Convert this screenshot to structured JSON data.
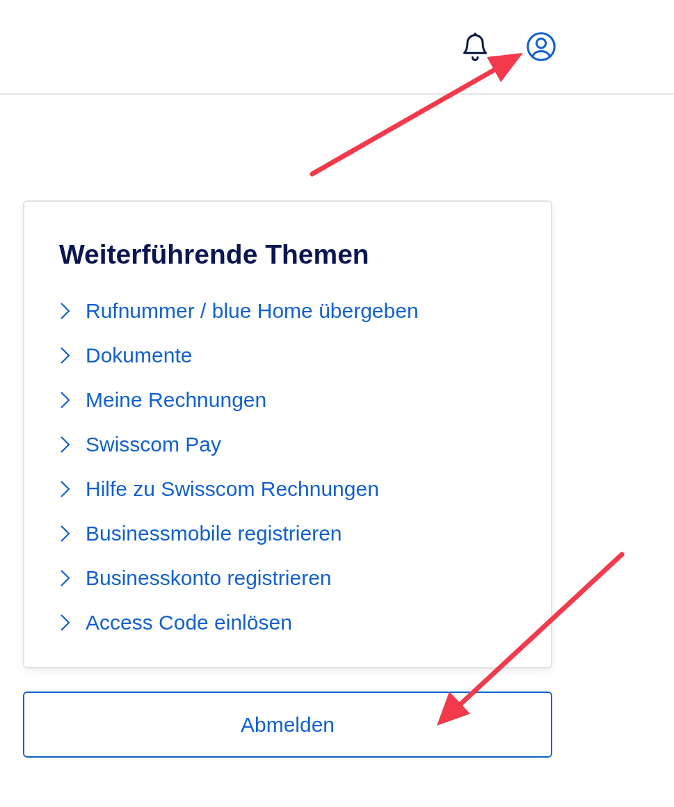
{
  "card": {
    "title": "Weiterführende Themen",
    "links": [
      {
        "label": "Rufnummer / blue Home übergeben"
      },
      {
        "label": "Dokumente"
      },
      {
        "label": "Meine Rechnungen"
      },
      {
        "label": "Swisscom Pay"
      },
      {
        "label": "Hilfe zu Swisscom Rechnungen"
      },
      {
        "label": "Businessmobile registrieren"
      },
      {
        "label": "Businesskonto registrieren"
      },
      {
        "label": "Access Code einlösen"
      }
    ]
  },
  "logout_button": {
    "label": "Abmelden"
  }
}
